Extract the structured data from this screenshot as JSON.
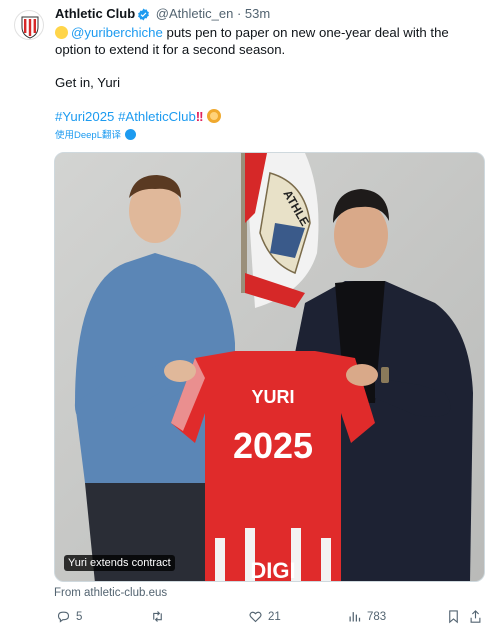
{
  "tweet": {
    "author_name": "Athletic Club",
    "handle": "@Athletic_en",
    "separator": "·",
    "time": "53m",
    "mention": "@yuriberchiche",
    "text_rest": " puts pen to paper on new one-year deal with the option to extend it for a second season.",
    "line2": "Get in, Yuri",
    "hashtag1": "#Yuri2025",
    "hashtag2": "#AthleticClub",
    "exclaim": "!!",
    "translate_label": "使用DeepL翻译"
  },
  "media": {
    "badge": "Yuri extends contract",
    "jersey_name": "YURI",
    "jersey_number": "2025",
    "sponsor": "DIGI",
    "flag_text": "ATHLE"
  },
  "source": "From athletic-club.eus",
  "actions": {
    "replies": "5",
    "likes": "21",
    "views": "783"
  },
  "colors": {
    "accent": "#1d9bf0",
    "muted": "#536471",
    "club_red": "#e02b2b"
  }
}
